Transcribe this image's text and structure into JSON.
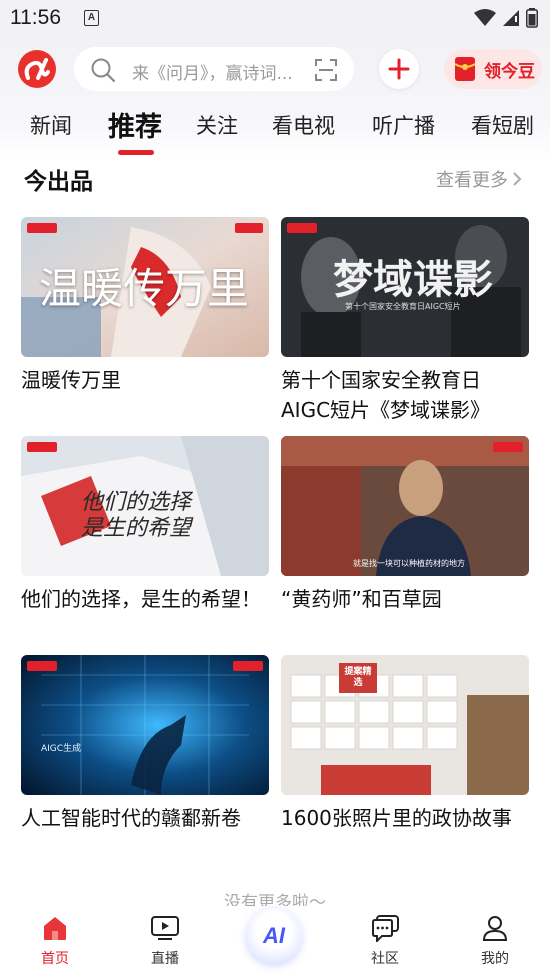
{
  "status_bar": {
    "time": "11:56",
    "notification_icon": "A"
  },
  "header": {
    "search_placeholder": "来《问月》，赢诗词...",
    "bean_label": "领今豆"
  },
  "tabs": [
    {
      "label": "新闻",
      "active": false
    },
    {
      "label": "推荐",
      "active": true
    },
    {
      "label": "关注",
      "active": false
    },
    {
      "label": "看电视",
      "active": false
    },
    {
      "label": "听广播",
      "active": false
    },
    {
      "label": "看短剧",
      "active": false
    }
  ],
  "section": {
    "title": "今出品",
    "more_label": "查看更多"
  },
  "cards": [
    {
      "title": "温暖传万里",
      "thumb_text": "温暖传万里",
      "thumb_badge_left": "今视频",
      "thumb_badge_right": "今视"
    },
    {
      "title": "第十个国家安全教育日AIGC短片《梦域谍影》",
      "thumb_text": "梦域谍影",
      "thumb_subtext": "第十个国家安全教育日AIGC短片",
      "thumb_badge_left": "今视频"
    },
    {
      "title": "他们的选择，是生的希望！",
      "thumb_text": "他们的选择 是生的希望",
      "thumb_badge_left": "今视频"
    },
    {
      "title": "“黄药师”和百草园",
      "thumb_subtext": "就是找一块可以种植药材的地方",
      "thumb_badge_right": "今视频"
    },
    {
      "title": "人工智能时代的赣鄱新卷",
      "thumb_subtext": "AIGC生成",
      "thumb_badge_right": "今视频"
    },
    {
      "title": "1600张照片里的政协故事",
      "thumb_text": "提案精选",
      "thumb_badge_left": ""
    }
  ],
  "footer_note": "没有更多啦～",
  "bottom_nav": {
    "items": [
      {
        "label": "首页",
        "icon": "home-icon",
        "active": true
      },
      {
        "label": "直播",
        "icon": "live-icon",
        "active": false
      },
      {
        "label": "AI",
        "icon": "ai-icon",
        "active": false
      },
      {
        "label": "社区",
        "icon": "community-icon",
        "active": false
      },
      {
        "label": "我的",
        "icon": "profile-icon",
        "active": false
      }
    ]
  },
  "colors": {
    "accent": "#e3212b",
    "ai_blue": "#4758f5",
    "muted": "#999999"
  }
}
